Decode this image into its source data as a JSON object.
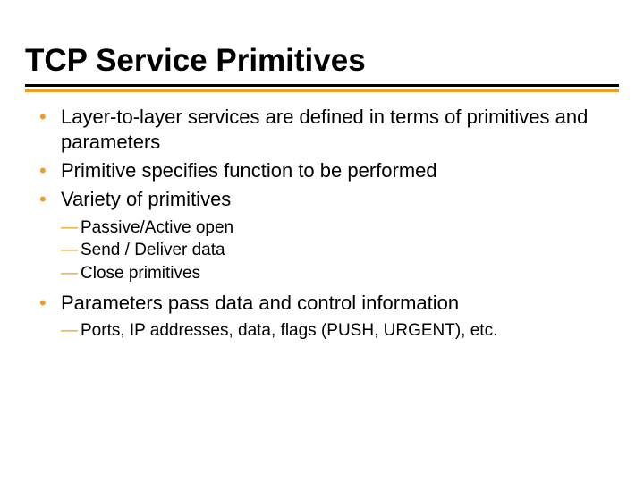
{
  "title": "TCP Service Primitives",
  "bullets": {
    "b1": "Layer-to-layer services are defined in terms of primitives and parameters",
    "b2": "Primitive specifies function to be performed",
    "b3": "Variety of primitives",
    "b3_sub": {
      "s1": "Passive/Active open",
      "s2": "Send / Deliver data",
      "s3": "Close primitives"
    },
    "b4": "Parameters pass data and control information",
    "b4_sub": {
      "s1": "Ports, IP addresses, data, flags (PUSH, URGENT), etc."
    }
  },
  "dash": "—"
}
